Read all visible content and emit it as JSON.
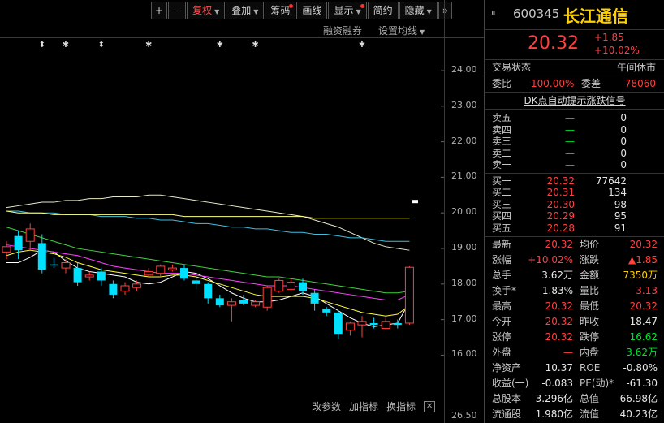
{
  "toolbar": {
    "buttons": [
      {
        "label": "+",
        "caret": false,
        "dot": false,
        "active": false
      },
      {
        "label": "—",
        "caret": false,
        "dot": false,
        "active": false
      },
      {
        "label": "复权",
        "caret": true,
        "dot": false,
        "active": true
      },
      {
        "label": "叠加",
        "caret": true,
        "dot": false,
        "active": false
      },
      {
        "label": "筹码",
        "caret": false,
        "dot": true,
        "active": false
      },
      {
        "label": "画线",
        "caret": false,
        "dot": false,
        "active": false
      },
      {
        "label": "显示",
        "caret": true,
        "dot": true,
        "active": false
      },
      {
        "label": "简约",
        "caret": false,
        "dot": false,
        "active": false
      },
      {
        "label": "隐藏",
        "caret": true,
        "dot": false,
        "active": false
      },
      {
        "label": "»",
        "caret": false,
        "dot": false,
        "active": false
      }
    ],
    "margin_trading": "融资融券",
    "ma_settings": "设置均线"
  },
  "axis": {
    "labels": [
      "24.00",
      "23.00",
      "22.00",
      "21.00",
      "20.00",
      "19.00",
      "18.00",
      "17.00",
      "16.00"
    ],
    "bottom_label": "26.50"
  },
  "bottom_toolbar": {
    "edit_params": "改参数",
    "add_indicator": "加指标",
    "switch_indicator": "换指标"
  },
  "chart_data": {
    "type": "candlestick",
    "ylim": [
      15.6,
      24.5
    ],
    "candles": [
      {
        "o": 18.9,
        "c": 19.05,
        "h": 19.2,
        "l": 18.7,
        "up": true
      },
      {
        "o": 19.35,
        "c": 18.95,
        "h": 19.5,
        "l": 18.7,
        "up": false
      },
      {
        "o": 19.2,
        "c": 19.55,
        "h": 19.7,
        "l": 18.95,
        "up": true
      },
      {
        "o": 19.15,
        "c": 18.4,
        "h": 19.4,
        "l": 18.3,
        "up": false
      },
      {
        "o": 18.55,
        "c": 18.55,
        "h": 18.75,
        "l": 18.45,
        "up": false
      },
      {
        "o": 18.45,
        "c": 18.6,
        "h": 18.7,
        "l": 18.3,
        "up": true
      },
      {
        "o": 18.45,
        "c": 18.05,
        "h": 18.6,
        "l": 17.95,
        "up": false
      },
      {
        "o": 18.2,
        "c": 18.25,
        "h": 18.35,
        "l": 18.1,
        "up": true
      },
      {
        "o": 18.35,
        "c": 18.1,
        "h": 18.45,
        "l": 17.95,
        "up": false
      },
      {
        "o": 18.0,
        "c": 17.7,
        "h": 18.1,
        "l": 17.6,
        "up": false
      },
      {
        "o": 17.8,
        "c": 17.95,
        "h": 18.05,
        "l": 17.7,
        "up": true
      },
      {
        "o": 17.9,
        "c": 18.0,
        "h": 18.1,
        "l": 17.8,
        "up": true
      },
      {
        "o": 18.25,
        "c": 18.35,
        "h": 18.45,
        "l": 18.15,
        "up": true
      },
      {
        "o": 18.3,
        "c": 18.5,
        "h": 18.55,
        "l": 18.2,
        "up": true
      },
      {
        "o": 18.4,
        "c": 18.45,
        "h": 18.55,
        "l": 18.35,
        "up": true
      },
      {
        "o": 18.45,
        "c": 18.15,
        "h": 18.55,
        "l": 18.1,
        "up": false
      },
      {
        "o": 18.1,
        "c": 18.0,
        "h": 18.2,
        "l": 17.85,
        "up": false
      },
      {
        "o": 18.0,
        "c": 17.6,
        "h": 18.05,
        "l": 17.45,
        "up": false
      },
      {
        "o": 17.6,
        "c": 17.4,
        "h": 17.7,
        "l": 17.35,
        "up": false
      },
      {
        "o": 17.4,
        "c": 17.5,
        "h": 17.6,
        "l": 16.95,
        "up": true
      },
      {
        "o": 17.55,
        "c": 17.45,
        "h": 17.7,
        "l": 17.4,
        "up": false
      },
      {
        "o": 17.4,
        "c": 17.5,
        "h": 17.55,
        "l": 17.35,
        "up": true
      },
      {
        "o": 17.35,
        "c": 17.9,
        "h": 17.95,
        "l": 17.25,
        "up": true
      },
      {
        "o": 17.8,
        "c": 18.1,
        "h": 18.15,
        "l": 17.75,
        "up": true
      },
      {
        "o": 17.85,
        "c": 18.05,
        "h": 18.15,
        "l": 17.8,
        "up": true
      },
      {
        "o": 18.05,
        "c": 17.8,
        "h": 18.15,
        "l": 17.7,
        "up": false
      },
      {
        "o": 17.75,
        "c": 17.45,
        "h": 17.85,
        "l": 17.25,
        "up": false
      },
      {
        "o": 17.3,
        "c": 17.2,
        "h": 17.35,
        "l": 17.1,
        "up": false
      },
      {
        "o": 17.2,
        "c": 16.6,
        "h": 17.25,
        "l": 16.45,
        "up": false
      },
      {
        "o": 16.7,
        "c": 16.9,
        "h": 16.95,
        "l": 16.55,
        "up": true
      },
      {
        "o": 16.85,
        "c": 16.95,
        "h": 17.1,
        "l": 16.5,
        "up": true
      },
      {
        "o": 16.9,
        "c": 16.85,
        "h": 17.05,
        "l": 16.75,
        "up": false
      },
      {
        "o": 16.75,
        "c": 16.95,
        "h": 17.05,
        "l": 16.7,
        "up": true
      },
      {
        "o": 16.85,
        "c": 16.9,
        "h": 17.0,
        "l": 16.75,
        "up": false
      },
      {
        "o": 16.9,
        "c": 18.47,
        "h": 18.5,
        "l": 16.85,
        "up": true
      }
    ],
    "moving_averages": [
      {
        "color": "#ffffff",
        "values": [
          18.6,
          18.6,
          18.75,
          18.95,
          18.9,
          18.65,
          18.45,
          18.35,
          18.3,
          18.25,
          18.2,
          18.05,
          18.0,
          18.05,
          18.2,
          18.35,
          18.3,
          18.15,
          17.95,
          17.75,
          17.6,
          17.5,
          17.5,
          17.55,
          17.65,
          17.75,
          17.65,
          17.45,
          17.25,
          17.05,
          16.9,
          16.8,
          16.85,
          16.9,
          17.5
        ]
      },
      {
        "color": "#ffff40",
        "values": [
          18.8,
          18.9,
          18.95,
          18.9,
          18.85,
          18.75,
          18.6,
          18.5,
          18.4,
          18.35,
          18.3,
          18.25,
          18.2,
          18.2,
          18.25,
          18.25,
          18.2,
          18.1,
          18.0,
          17.9,
          17.8,
          17.7,
          17.65,
          17.65,
          17.65,
          17.65,
          17.6,
          17.5,
          17.4,
          17.3,
          17.2,
          17.15,
          17.1,
          17.15,
          17.4
        ]
      },
      {
        "color": "#ff40ff",
        "values": [
          19.1,
          19.05,
          19.0,
          18.95,
          18.9,
          18.85,
          18.8,
          18.7,
          18.6,
          18.5,
          18.45,
          18.4,
          18.35,
          18.3,
          18.3,
          18.3,
          18.25,
          18.2,
          18.15,
          18.1,
          18.05,
          18.0,
          17.95,
          17.95,
          17.95,
          17.9,
          17.85,
          17.8,
          17.75,
          17.7,
          17.65,
          17.6,
          17.55,
          17.55,
          17.7
        ]
      },
      {
        "color": "#40d040",
        "values": [
          19.6,
          19.5,
          19.4,
          19.3,
          19.2,
          19.1,
          19.0,
          18.95,
          18.9,
          18.85,
          18.8,
          18.75,
          18.7,
          18.65,
          18.6,
          18.55,
          18.5,
          18.45,
          18.4,
          18.35,
          18.3,
          18.25,
          18.2,
          18.2,
          18.15,
          18.1,
          18.05,
          18.0,
          17.95,
          17.9,
          17.85,
          17.8,
          17.75,
          17.75,
          17.8
        ]
      },
      {
        "color": "#e8e8c8",
        "values": [
          20.15,
          20.2,
          20.25,
          20.3,
          20.3,
          20.35,
          20.35,
          20.4,
          20.4,
          20.45,
          20.45,
          20.45,
          20.5,
          20.5,
          20.45,
          20.4,
          20.35,
          20.3,
          20.25,
          20.2,
          20.15,
          20.1,
          20.05,
          20.0,
          19.95,
          19.9,
          19.8,
          19.7,
          19.6,
          19.45,
          19.3,
          19.15,
          19.05,
          19.0,
          18.95
        ]
      },
      {
        "color": "#40c0e0",
        "values": [
          20.05,
          20.05,
          20.0,
          20.0,
          20.0,
          19.95,
          19.95,
          19.95,
          19.9,
          19.9,
          19.9,
          19.85,
          19.85,
          19.8,
          19.8,
          19.75,
          19.7,
          19.7,
          19.65,
          19.6,
          19.6,
          19.55,
          19.55,
          19.5,
          19.45,
          19.45,
          19.4,
          19.4,
          19.35,
          19.3,
          19.3,
          19.25,
          19.2,
          19.2,
          19.2
        ]
      },
      {
        "color": "#ffff80",
        "values": [
          20.05,
          20.0,
          20.0,
          20.0,
          19.95,
          19.95,
          19.95,
          19.95,
          19.95,
          19.95,
          19.95,
          19.95,
          19.95,
          19.95,
          19.95,
          19.9,
          19.9,
          19.9,
          19.9,
          19.9,
          19.9,
          19.9,
          19.9,
          19.9,
          19.9,
          19.9,
          19.85,
          19.85,
          19.85,
          19.85,
          19.85,
          19.85,
          19.85,
          19.85,
          19.85
        ]
      }
    ],
    "markers": [
      {
        "index": 3,
        "glyph": "⬍"
      },
      {
        "index": 5,
        "glyph": "✱"
      },
      {
        "index": 8,
        "glyph": "⬍"
      },
      {
        "index": 12,
        "glyph": "✱"
      },
      {
        "index": 18,
        "glyph": "✱"
      },
      {
        "index": 21,
        "glyph": "✱"
      },
      {
        "index": 30,
        "glyph": "✱"
      }
    ]
  },
  "quote": {
    "code": "600345",
    "name": "长江通信",
    "price": "20.32",
    "change": "+1.85",
    "change_pct": "+10.02%",
    "collapse_icon": "⏸",
    "trade_status_label": "交易状态",
    "trade_status_value": "午间休市",
    "wb_label": "委比",
    "wb_value": "100.00%",
    "wc_label": "委差",
    "wc_value": "78060",
    "dk_link": "DK点自动提示涨跌信号",
    "asks": [
      {
        "label": "卖五",
        "price": "—",
        "vol": "0"
      },
      {
        "label": "卖四",
        "price": "—",
        "vol": "0"
      },
      {
        "label": "卖三",
        "price": "—",
        "vol": "0"
      },
      {
        "label": "卖二",
        "price": "—",
        "vol": "0"
      },
      {
        "label": "卖一",
        "price": "—",
        "vol": "0"
      }
    ],
    "bids": [
      {
        "label": "买一",
        "price": "20.32",
        "vol": "77642"
      },
      {
        "label": "买二",
        "price": "20.31",
        "vol": "134"
      },
      {
        "label": "买三",
        "price": "20.30",
        "vol": "98"
      },
      {
        "label": "买四",
        "price": "20.29",
        "vol": "95"
      },
      {
        "label": "买五",
        "price": "20.28",
        "vol": "91"
      }
    ],
    "stats": [
      {
        "a": "最新",
        "b": "20.32",
        "bc": "red",
        "c": "均价",
        "d": "20.32",
        "dc": "red"
      },
      {
        "a": "涨幅",
        "b": "+10.02%",
        "bc": "red",
        "c": "涨跌",
        "d": "▲1.85",
        "dc": "red"
      },
      {
        "a": "总手",
        "b": "3.62万",
        "bc": "white",
        "c": "金额",
        "d": "7350万",
        "dc": "yellow"
      },
      {
        "a": "换手*",
        "b": "1.83%",
        "bc": "white",
        "c": "量比",
        "d": "3.13",
        "dc": "red"
      },
      {
        "a": "最高",
        "b": "20.32",
        "bc": "red",
        "c": "最低",
        "d": "20.32",
        "dc": "red"
      },
      {
        "a": "今开",
        "b": "20.32",
        "bc": "red",
        "c": "昨收",
        "d": "18.47",
        "dc": "white"
      },
      {
        "a": "涨停",
        "b": "20.32",
        "bc": "red",
        "c": "跌停",
        "d": "16.62",
        "dc": "green"
      },
      {
        "a": "外盘",
        "b": "—",
        "bc": "red",
        "c": "内盘",
        "d": "3.62万",
        "dc": "green"
      },
      {
        "a": "净资产",
        "b": "10.37",
        "bc": "white",
        "c": "ROE",
        "d": "-0.80%",
        "dc": "white"
      },
      {
        "a": "收益(一)",
        "b": "-0.083",
        "bc": "white",
        "c": "PE(动)*",
        "d": "-61.30",
        "dc": "white"
      },
      {
        "a": "总股本",
        "b": "3.296亿",
        "bc": "white",
        "c": "总值",
        "d": "66.98亿",
        "dc": "white"
      },
      {
        "a": "流通股",
        "b": "1.980亿",
        "bc": "white",
        "c": "流值",
        "d": "40.23亿",
        "dc": "white"
      }
    ]
  },
  "colors": {
    "up": "#ff4040",
    "down": "#00e0ff",
    "flat": "#ffffff"
  }
}
